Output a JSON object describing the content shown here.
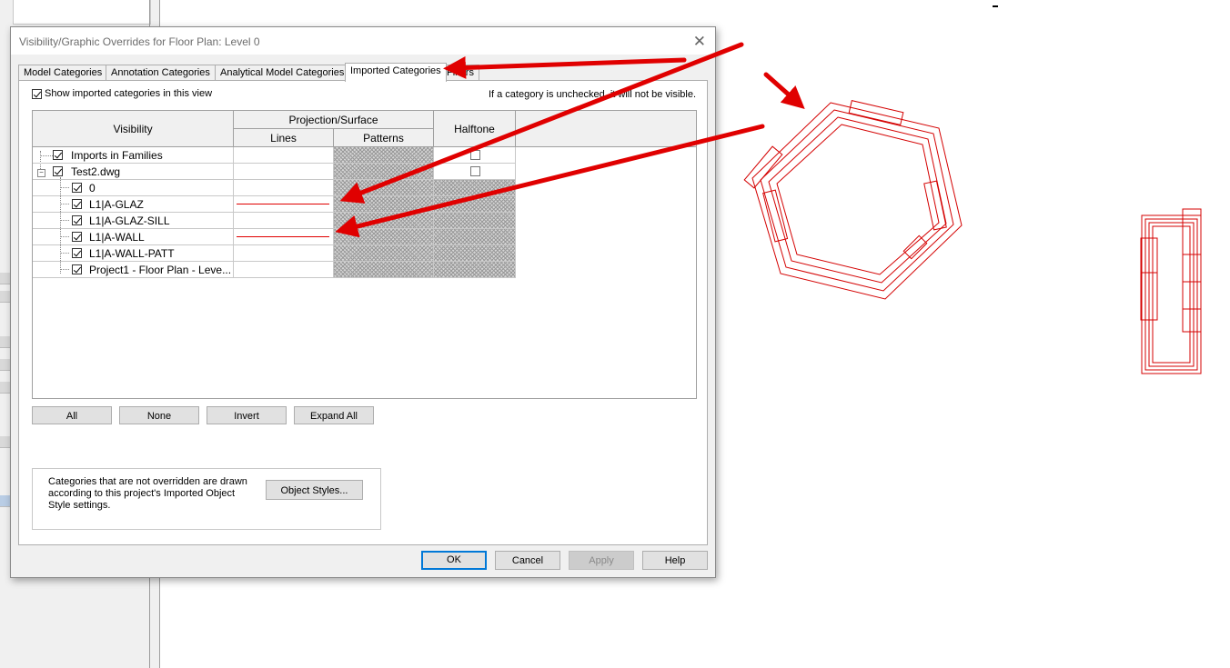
{
  "dialog": {
    "title": "Visibility/Graphic Overrides for Floor Plan: Level 0",
    "close_glyph": "✕",
    "tabs": [
      {
        "label": "Model Categories",
        "active": false
      },
      {
        "label": "Annotation Categories",
        "active": false
      },
      {
        "label": "Analytical Model Categories",
        "active": false
      },
      {
        "label": "Imported Categories",
        "active": true
      },
      {
        "label": "Filters",
        "active": false
      }
    ],
    "show_checkbox_label": "Show imported categories in this view",
    "show_checkbox_checked": true,
    "hint_text": "If a category is unchecked, it will not be visible.",
    "columns": {
      "visibility": "Visibility",
      "projection_surface": "Projection/Surface",
      "lines": "Lines",
      "patterns": "Patterns",
      "halftone": "Halftone"
    },
    "rows": [
      {
        "label": "Imports in Families",
        "checked": true,
        "level": 0,
        "halftone_checkbox": true,
        "lines_override": false
      },
      {
        "label": "Test2.dwg",
        "checked": true,
        "level": 0,
        "expandable": true,
        "halftone_checkbox": true,
        "lines_override": false
      },
      {
        "label": "0",
        "checked": true,
        "level": 1,
        "lines_override": false
      },
      {
        "label": "L1|A-GLAZ",
        "checked": true,
        "level": 1,
        "lines_override": true
      },
      {
        "label": "L1|A-GLAZ-SILL",
        "checked": true,
        "level": 1,
        "lines_override": false
      },
      {
        "label": "L1|A-WALL",
        "checked": true,
        "level": 1,
        "lines_override": true
      },
      {
        "label": "L1|A-WALL-PATT",
        "checked": true,
        "level": 1,
        "lines_override": false
      },
      {
        "label": "Project1 - Floor Plan - Leve...",
        "checked": true,
        "level": 1,
        "lines_override": false
      }
    ],
    "row_buttons": {
      "all": "All",
      "none": "None",
      "invert": "Invert",
      "expand_all": "Expand All"
    },
    "note_text": "Categories that are not overridden are drawn according to this project's Imported Object Style settings.",
    "object_styles_label": "Object Styles...",
    "footer": {
      "ok": "OK",
      "cancel": "Cancel",
      "apply": "Apply",
      "help": "Help"
    }
  },
  "colors": {
    "override_line": "#e00000",
    "annotation_arrow": "#e00000",
    "cad_linework": "#d40000",
    "ok_focus": "#0078d7"
  }
}
